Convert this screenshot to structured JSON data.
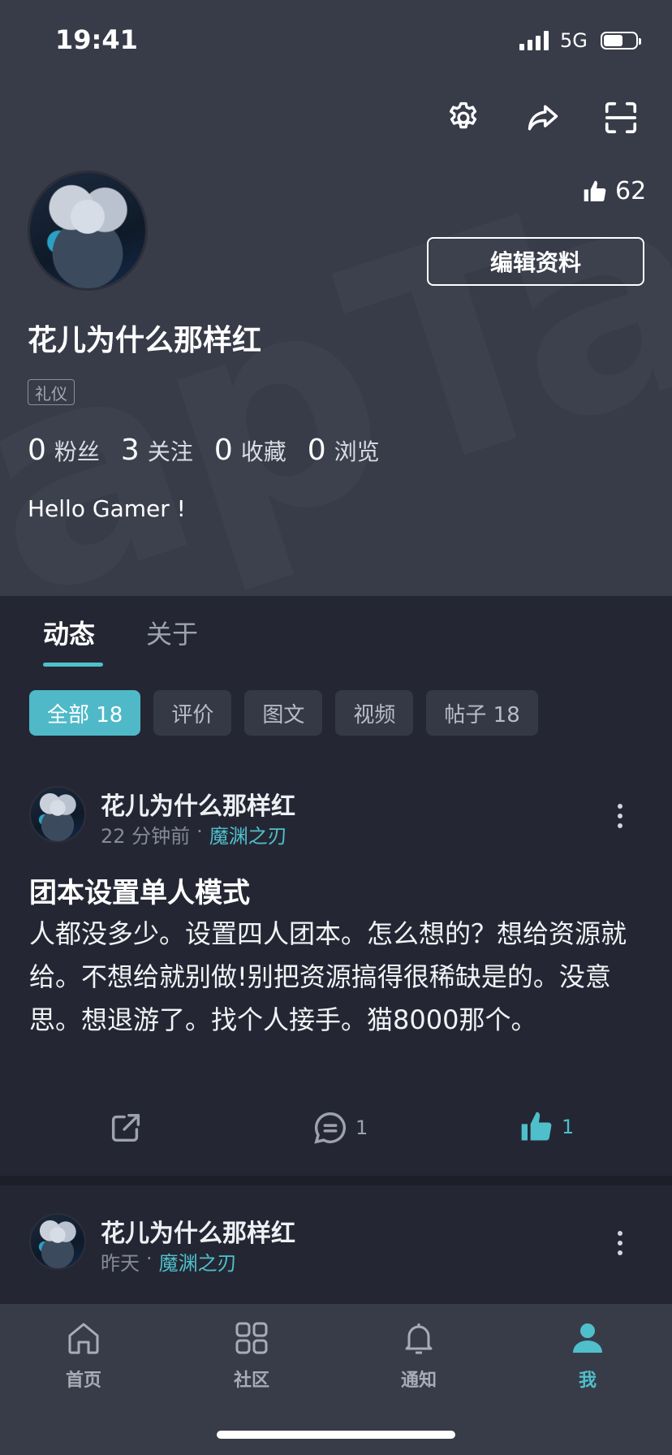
{
  "status_bar": {
    "time": "19:41",
    "network": "5G"
  },
  "header": {
    "watermark": "apTap",
    "likes_count": "62",
    "edit_button": "编辑资料",
    "username": "花儿为什么那样红",
    "tag": "礼仪",
    "stats": [
      {
        "num": "0",
        "label": "粉丝"
      },
      {
        "num": "3",
        "label": "关注"
      },
      {
        "num": "0",
        "label": "收藏"
      },
      {
        "num": "0",
        "label": "浏览"
      }
    ],
    "bio": "Hello Gamer !"
  },
  "tabs": [
    {
      "label": "动态",
      "active": true
    },
    {
      "label": "关于",
      "active": false
    }
  ],
  "filters": [
    {
      "label": "全部 18",
      "active": true
    },
    {
      "label": "评价",
      "active": false
    },
    {
      "label": "图文",
      "active": false
    },
    {
      "label": "视频",
      "active": false
    },
    {
      "label": "帖子 18",
      "active": false
    }
  ],
  "posts": [
    {
      "author": "花儿为什么那样红",
      "time": "22 分钟前",
      "separator": "·",
      "game": "魔渊之刃",
      "title": "团本设置单人模式",
      "body": "人都没多少。设置四人团本。怎么想的？想给资源就给。不想给就别做!别把资源搞得很稀缺是的。没意思。想退游了。找个人接手。猫8000那个。",
      "comments": "1",
      "likes": "1"
    },
    {
      "author": "花儿为什么那样红",
      "time": "昨天",
      "separator": "·",
      "game": "魔渊之刃"
    }
  ],
  "bottom_nav": [
    {
      "label": "首页",
      "icon": "home-icon",
      "active": false
    },
    {
      "label": "社区",
      "icon": "grid-icon",
      "active": false
    },
    {
      "label": "通知",
      "icon": "bell-icon",
      "active": false
    },
    {
      "label": "我",
      "icon": "user-icon",
      "active": true
    }
  ],
  "colors": {
    "accent": "#4fbfcc",
    "header_bg": "#383c49",
    "page_bg": "#242733"
  }
}
